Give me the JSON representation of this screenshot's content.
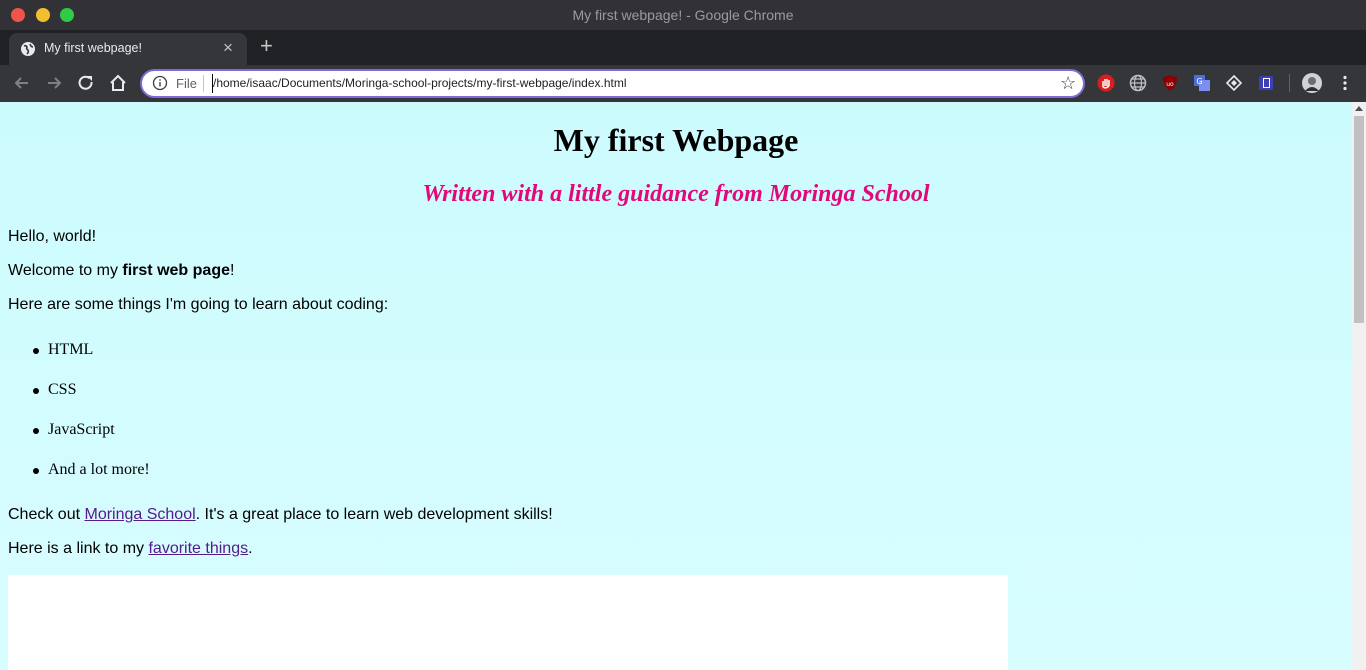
{
  "window": {
    "title": "My first webpage! - Google Chrome"
  },
  "tab": {
    "title": "My first webpage!",
    "close": "×",
    "new_tab": "+"
  },
  "omnibox": {
    "scheme_label": "File",
    "url": "/home/isaac/Documents/Moringa-school-projects/my-first-webpage/index.html"
  },
  "icons": {
    "back": "arrow-left-icon",
    "forward": "arrow-right-icon",
    "reload": "reload-icon",
    "home": "home-icon",
    "star": "star-icon",
    "extensions": [
      "hand-stop-icon",
      "globe-icon",
      "ublock-shield-icon",
      "translate-icon",
      "diamond-icon",
      "book-icon"
    ],
    "avatar": "avatar-icon",
    "menu": "kebab-menu-icon"
  },
  "page": {
    "heading": "My first Webpage",
    "subheading": "Written with a little guidance from Moringa School",
    "greeting": "Hello, world!",
    "welcome_prefix": "Welcome to my ",
    "welcome_bold": "first web page",
    "welcome_suffix": "!",
    "learn_intro": "Here are some things I'm going to learn about coding:",
    "learn_items": [
      "HTML",
      "CSS",
      "JavaScript",
      "And a lot more!"
    ],
    "checkout_prefix": "Check out ",
    "checkout_link": "Moringa School",
    "checkout_suffix": ". It's a great place to learn web development skills!",
    "fav_prefix": "Here is a link to my ",
    "fav_link": "favorite things",
    "fav_suffix": "."
  },
  "colors": {
    "page_background": "#ccfbfe",
    "subheading": "#e3087a",
    "link": "#551a8b",
    "omnibox_focus": "#7b6cd9"
  }
}
